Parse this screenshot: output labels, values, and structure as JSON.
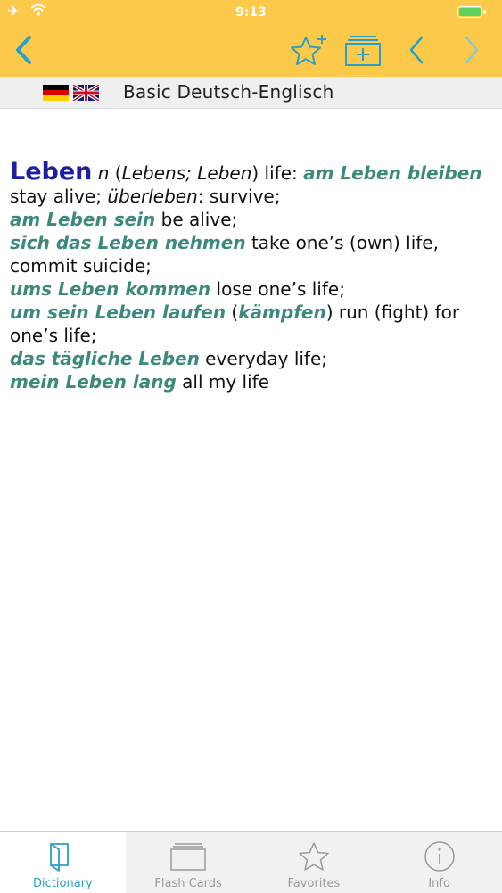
{
  "status_bar": {
    "time": "9:13",
    "airplane_icon": "airplane-icon",
    "wifi_icon": "wifi-icon",
    "battery_icon": "battery-icon"
  },
  "nav": {
    "back_icon": "chevron-left-icon",
    "favorite_icon": "star-plus-icon",
    "flashcard_icon": "add-to-flashcards-icon",
    "prev_icon": "chevron-left-icon",
    "next_icon": "chevron-right-icon"
  },
  "dictionary": {
    "title": "Basic Deutsch-Englisch",
    "flags": [
      "german-flag-icon",
      "uk-flag-icon"
    ]
  },
  "entry": {
    "headword": "Leben",
    "grammar": "n",
    "forms": "Lebens; Leben",
    "translation": "life",
    "lines": [
      {
        "phrase": "am Leben bleiben",
        "meaning": "stay alive;",
        "alt": "überleben",
        "alt_meaning": "survive;"
      },
      {
        "phrase": "am Leben sein",
        "meaning": "be alive;"
      },
      {
        "phrase": "sich das Leben nehmen",
        "meaning": "take one’s (own) life, commit suicide;"
      },
      {
        "phrase": "ums Leben kommen",
        "meaning": "lose one’s life;"
      },
      {
        "phrase": "um sein Leben laufen",
        "alt_phrase": "kämpfen",
        "meaning": "run (fight) for one’s life;"
      },
      {
        "phrase": "das tägliche Leben",
        "meaning": "everyday life;"
      },
      {
        "phrase": "mein Leben lang",
        "meaning": "all my life"
      }
    ]
  },
  "tabs": [
    {
      "label": "Dictionary",
      "icon": "book-icon",
      "active": true
    },
    {
      "label": "Flash Cards",
      "icon": "cards-icon",
      "active": false
    },
    {
      "label": "Favorites",
      "icon": "star-icon",
      "active": false
    },
    {
      "label": "Info",
      "icon": "info-icon",
      "active": false
    }
  ],
  "colors": {
    "nav_bar": "#fcc94a",
    "nav_icon": "#2a9fc9",
    "headword": "#1e1ea0",
    "phrase": "#3d8a7d",
    "tab_active": "#2a9fc9"
  }
}
